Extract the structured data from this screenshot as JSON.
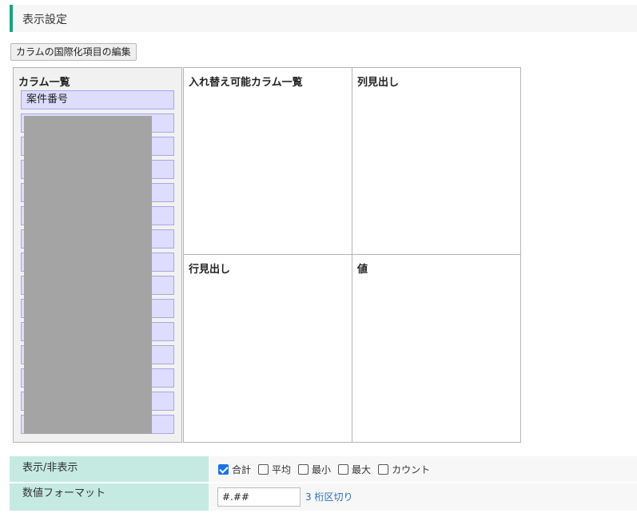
{
  "section": {
    "title": "表示設定"
  },
  "toolbar": {
    "i18n_button": "カラムの国際化項目の編集"
  },
  "column_list": {
    "title": "カラム一覧",
    "items": [
      {
        "label": "案件番号"
      },
      {
        "label": ""
      },
      {
        "label": ""
      },
      {
        "label": ""
      },
      {
        "label": ""
      },
      {
        "label": ""
      },
      {
        "label": ""
      },
      {
        "label": ""
      },
      {
        "label": ""
      },
      {
        "label": ""
      },
      {
        "label": ""
      },
      {
        "label": ""
      },
      {
        "label": ""
      },
      {
        "label": ""
      },
      {
        "label": ""
      }
    ]
  },
  "pivot": {
    "swappable_title": "入れ替え可能カラム一覧",
    "column_header_title": "列見出し",
    "row_header_title": "行見出し",
    "values_title": "値"
  },
  "display": {
    "label": "表示/非表示",
    "options": [
      {
        "label": "合計",
        "checked": true
      },
      {
        "label": "平均",
        "checked": false
      },
      {
        "label": "最小",
        "checked": false
      },
      {
        "label": "最大",
        "checked": false
      },
      {
        "label": "カウント",
        "checked": false
      }
    ]
  },
  "number_format": {
    "label": "数値フォーマット",
    "value": "#.##",
    "link": "3 桁区切り"
  }
}
